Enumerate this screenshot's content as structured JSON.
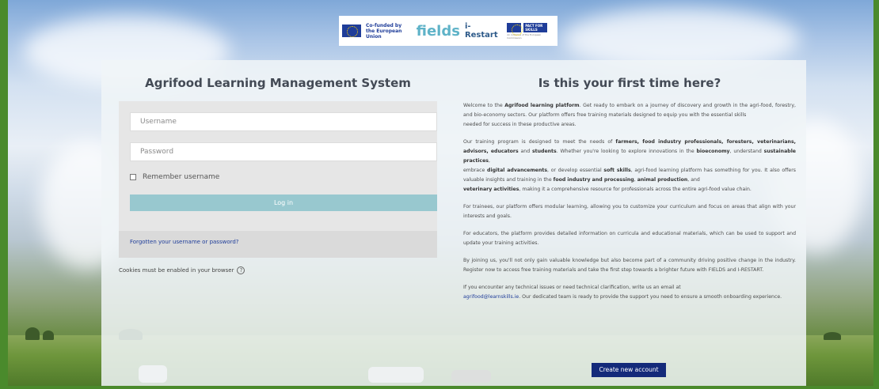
{
  "logo_banner": {
    "eu_text_line1": "Co-funded by",
    "eu_text_line2": "the European Union",
    "fields_text": "fields",
    "restart_text": "i-Restart",
    "pact_text_line1": "PACT FOR",
    "pact_text_line2": "SKILLS",
    "pact_sub": "An initiative of the European Commission"
  },
  "login": {
    "title": "Agrifood Learning Management System",
    "username_placeholder": "Username",
    "password_placeholder": "Password",
    "remember_label": "Remember username",
    "login_button": "Log in",
    "forgot_link": "Forgotten your username or password?",
    "cookies_note": "Cookies must be enabled in your browser",
    "help_icon": "question-circle-icon"
  },
  "intro": {
    "title": "Is this your first time here?",
    "p1_a": "Welcome to the ",
    "p1_b": "Agrifood learning platform",
    "p1_c": ". Get ready to embark on a journey of discovery and growth in the agri-food, forestry, and bio-economy sectors. Our platform offers free training materials designed to equip you with the essential skills",
    "p1_d": "needed for success in these productive areas.",
    "p2_a": "Our training program is designed to meet the needs of ",
    "p2_b": "farmers, food industry professionals, foresters, veterinarians, advisors, educators",
    "p2_c": " and ",
    "p2_d": "students",
    "p2_e": ". Whether you're looking to explore innovations in the ",
    "p2_f": "bioeconomy",
    "p2_g": ", understand ",
    "p2_h": "sustainable practices",
    "p2_i": ",",
    "p2_j": "embrace ",
    "p2_k": "digital advancements",
    "p2_l": ", or develop essential ",
    "p2_m": "soft skills",
    "p2_n": ", agri-food learning platform has something for you. It also offers valuable insights and training in the ",
    "p2_o": "food industry and processing",
    "p2_p": ", ",
    "p2_q": "animal production",
    "p2_r": ", and",
    "p2_s": "veterinary activities",
    "p2_t": ", making it a comprehensive resource for professionals across the entire agri-food value chain.",
    "p3": "For trainees, our platform offers modular learning, allowing you to customize your curriculum and focus on areas that align with your interests and goals.",
    "p4": "For educators, the platform provides detailed information on curricula and educational materials, which can be used to support and update your training activities.",
    "p5": "By joining us, you'll not only gain valuable knowledge but also become part of a community driving positive change in the industry. Register now to access free training materials and take the first step towards a brighter future with FIELDS and I-RESTART.",
    "p6_a": "If you encounter any technical issues or need technical clarification, write us an email at",
    "p6_email": "agrifood@learnskills.ie",
    "p6_b": ". Our dedicated team is ready to provide the support you need to ensure a smooth onboarding experience.",
    "create_button": "Create new account"
  }
}
